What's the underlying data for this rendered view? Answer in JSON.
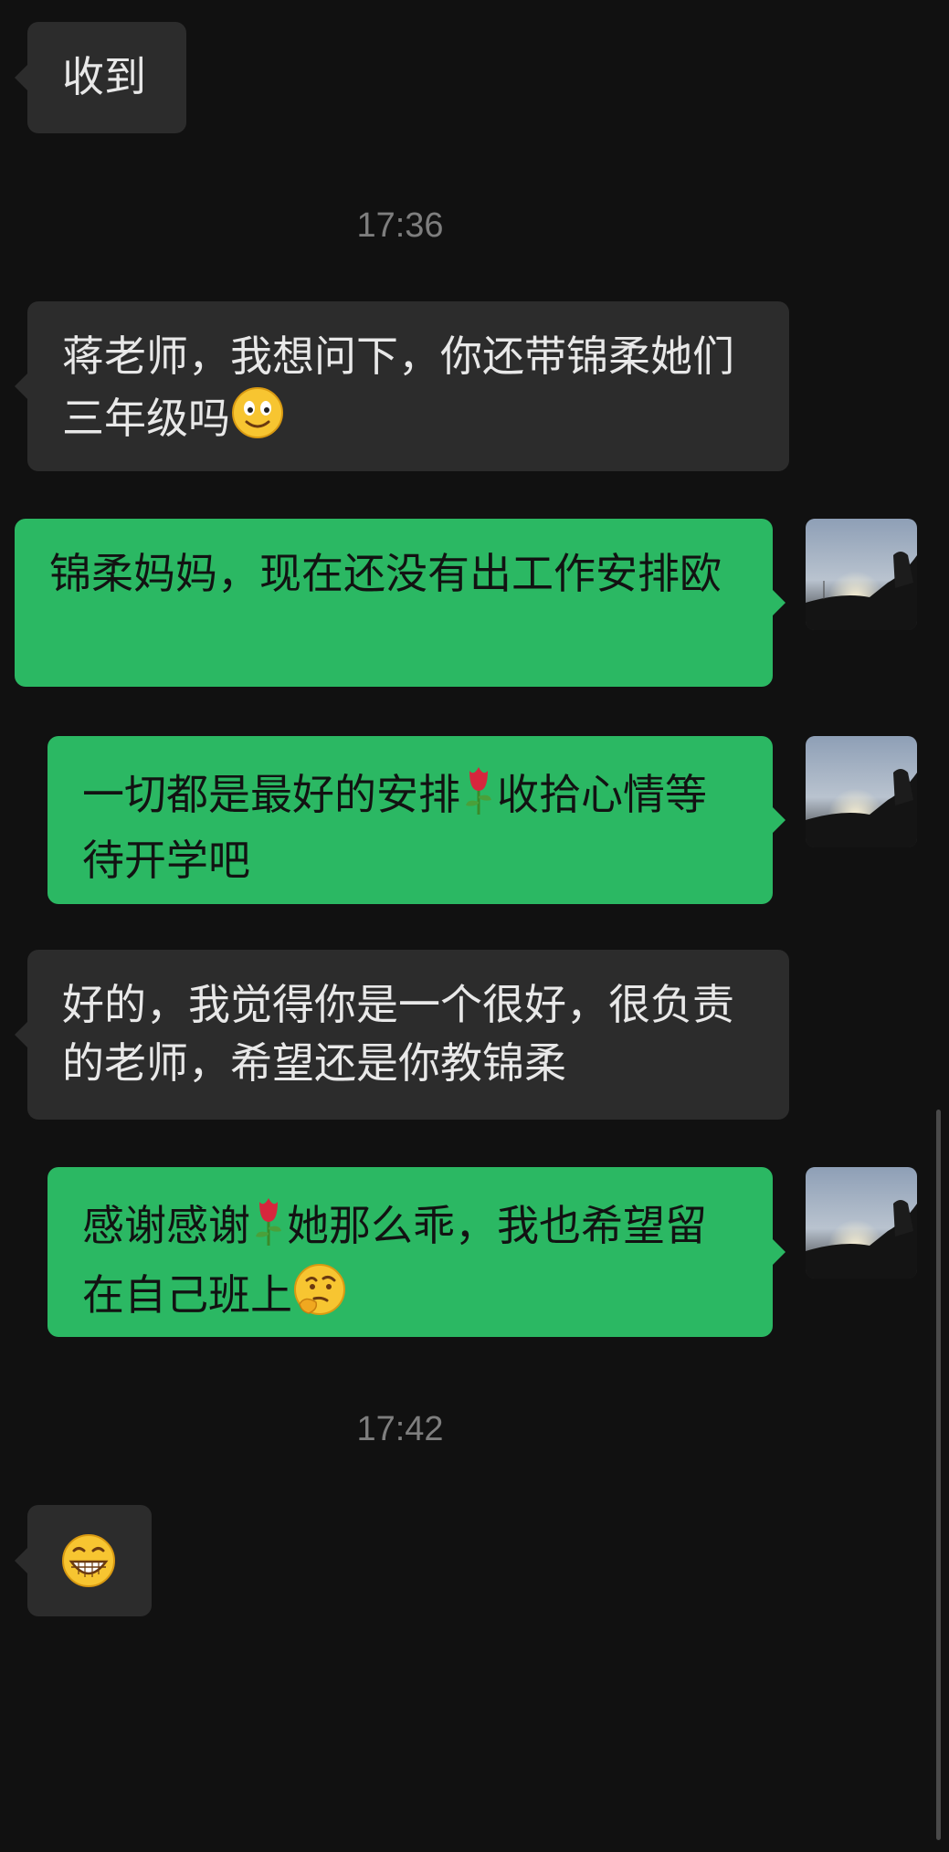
{
  "messages": [
    {
      "side": "in",
      "text": "收到"
    },
    {
      "side": "in",
      "text": "蒋老师，我想问下，你还带锦柔她们三年级吗",
      "emoji_after": "smile-emoji"
    },
    {
      "side": "out",
      "text": "锦柔妈妈，现在还没有出工作安排欧"
    },
    {
      "side": "out",
      "text_before": "一切都是最好的安排",
      "emoji_mid": "rose-emoji",
      "text_after": "收拾心情等待开学吧"
    },
    {
      "side": "in",
      "text": "好的，我觉得你是一个很好，很负责的老师，希望还是你教锦柔"
    },
    {
      "side": "out",
      "text_before": "感谢感谢",
      "emoji_mid": "rose-emoji",
      "text_after": "她那么乖，我也希望留在自己班上",
      "emoji_after": "thinking-emoji"
    },
    {
      "side": "in",
      "emoji_only": "grin-emoji"
    }
  ],
  "timestamps": [
    "17:36",
    "17:42"
  ],
  "colors": {
    "background": "#111111",
    "incoming_bubble": "#2c2c2c",
    "outgoing_bubble": "#2bb863",
    "timestamp_text": "#7e7e7e"
  }
}
